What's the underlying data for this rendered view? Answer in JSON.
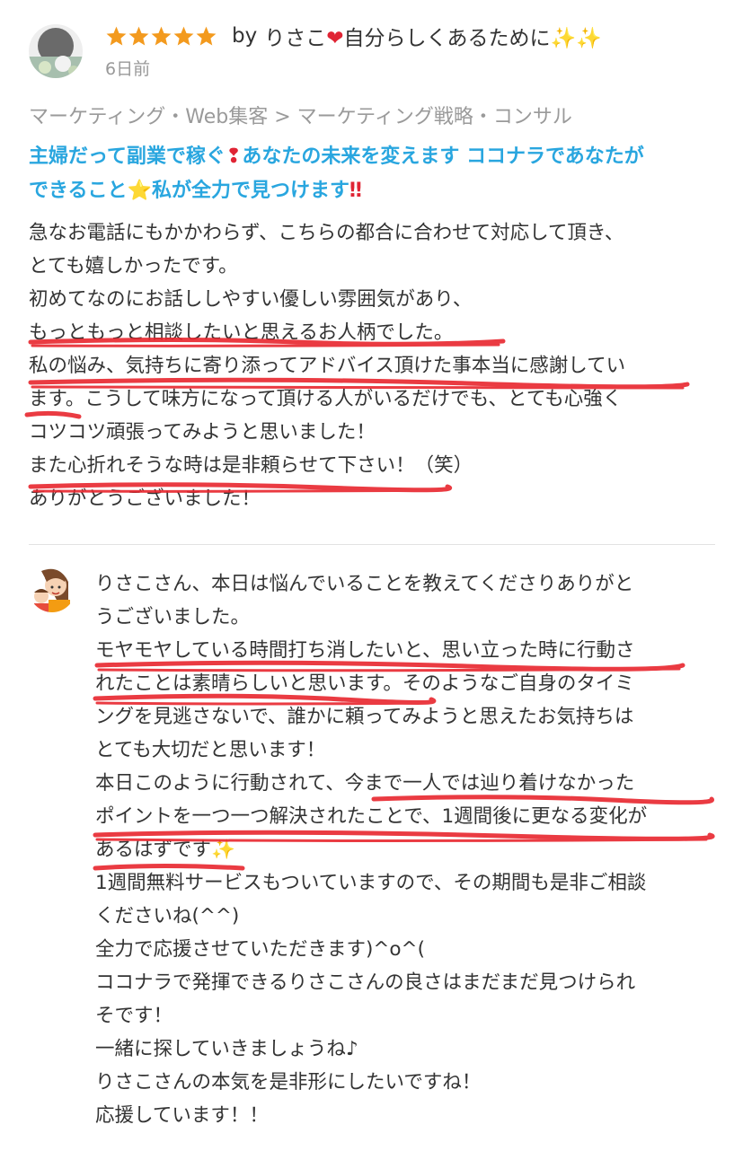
{
  "review": {
    "rating": 5,
    "by_label": "by",
    "reviewer_name": "りさこ",
    "reviewer_name_suffix": "自分らしくあるために",
    "time_ago": "6日前",
    "breadcrumb": "マーケティング・Web集客 > マーケティング戦略・コンサル",
    "service_title_part1": "主婦だって副業で稼ぐ",
    "service_title_part2": "あなたの未来を変えます ココナラであなたが",
    "service_title_part3": "できること",
    "service_title_part4": "私が全力で見つけます",
    "body_lines": [
      "急なお電話にもかかわらず、こちらの都合に合わせて対応して頂き、",
      "とても嬉しかったです。",
      "初めてなのにお話ししやすい優しい雰囲気があり、",
      "もっともっと相談したいと思えるお人柄でした。",
      "私の悩み、気持ちに寄り添ってアドバイス頂けた事本当に感謝してい",
      "ます。こうして味方になって頂ける人がいるだけでも、とても心強く",
      "コツコツ頑張ってみようと思いました！",
      "また心折れそうな時は是非頼らせて下さい！（笑）",
      "ありがとうございました！"
    ]
  },
  "reply": {
    "body_lines": [
      "りさこさん、本日は悩んでいることを教えてくださりありがと",
      "うございました。",
      "モヤモヤしている時間打ち消したいと、思い立った時に行動さ",
      "れたことは素晴らしいと思います。そのようなご自身のタイミ",
      "ングを見逃さないで、誰かに頼ってみようと思えたお気持ちは",
      "とても大切だと思います！",
      "本日このように行動されて、今まで一人では辿り着けなかった",
      "ポイントを一つ一つ解決されたことで、1週間後に更なる変化が",
      "あるはずです",
      "1週間無料サービスもついていますので、その期間も是非ご相談",
      "くださいね(^^)",
      "全力で応援させていただきます)^o^(",
      "ココナラで発揮できるりさこさんの良さはまだまだ見つけられ",
      "そです！",
      "一緒に探していきましょうね♪",
      "りさこさんの本気を是非形にしたいですね！",
      "応援しています！！"
    ]
  },
  "colors": {
    "star": "#f39a1e",
    "title_blue": "#29a6df",
    "emoji_red": "#e02434",
    "underline_red": "#e8262e"
  },
  "icons": {
    "heart": "❤",
    "sparkles": "✨✨",
    "sparkle": "✨",
    "exclamation": "❢",
    "star_emoji": "⭐",
    "double_exclamation": "‼"
  }
}
